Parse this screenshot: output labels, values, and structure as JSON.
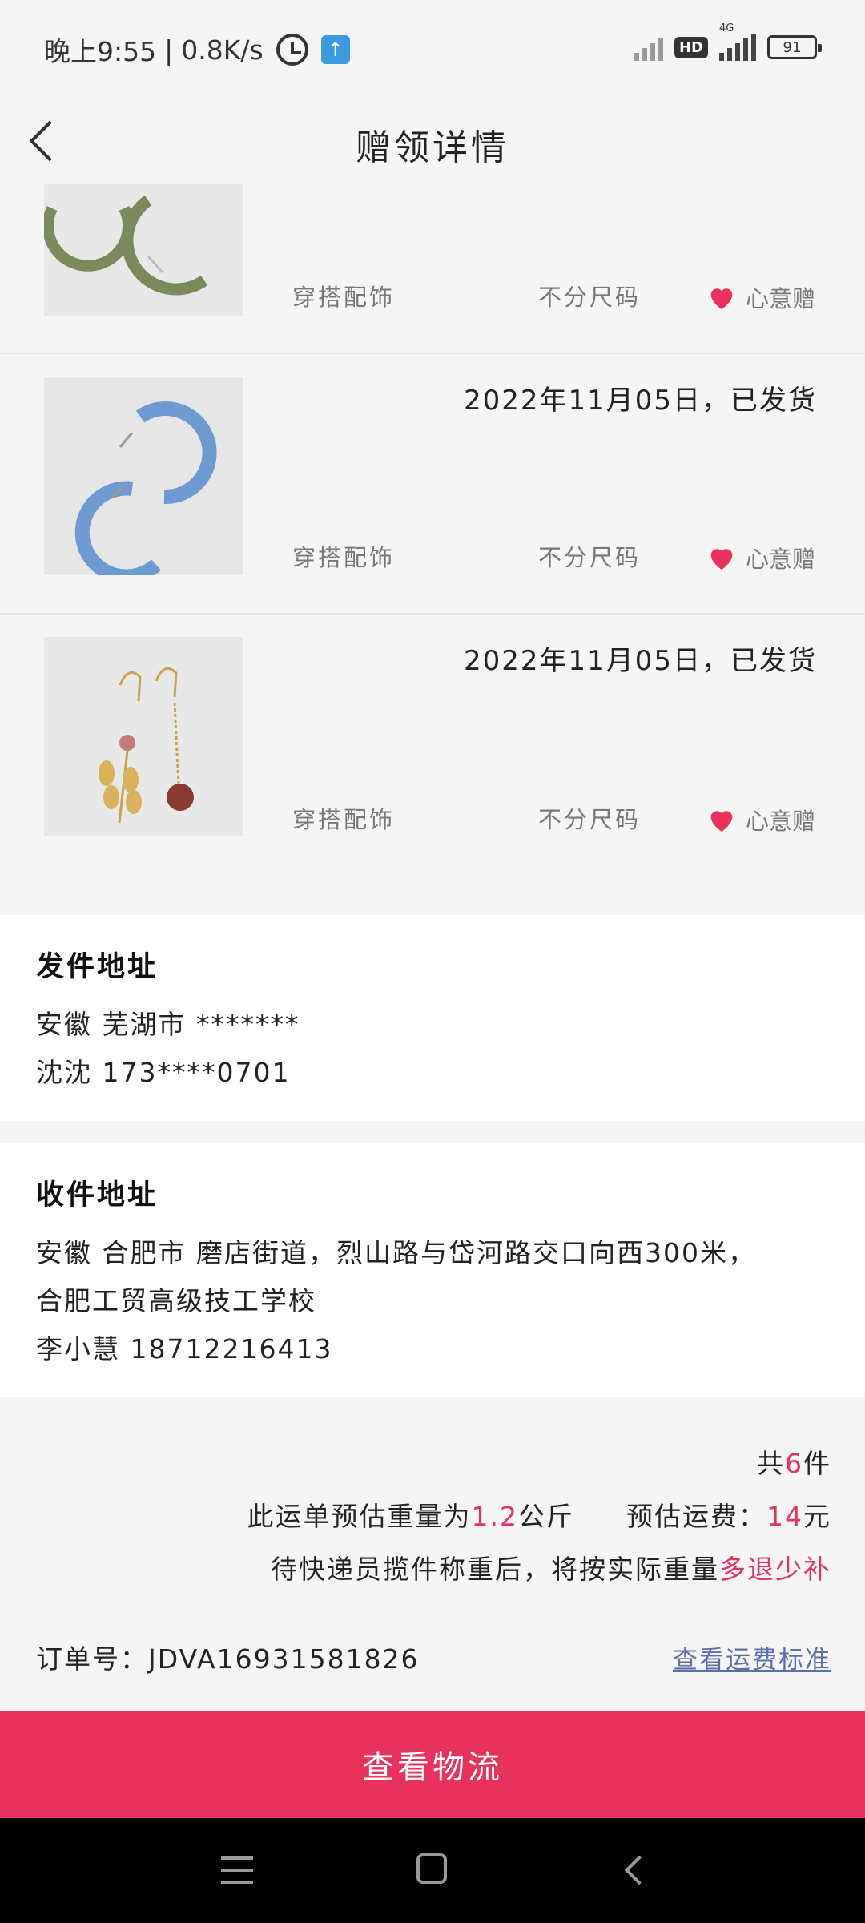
{
  "status_bar": {
    "time": "晚上9:55",
    "separator": "|",
    "speed": "0.8K/s",
    "battery": "91",
    "network_badge": "HD",
    "network_type": "4G"
  },
  "header": {
    "title": "赠领详情"
  },
  "items": [
    {
      "ship_date": "",
      "category": "穿搭配饰",
      "size": "不分尺码",
      "like_label": "心意赠",
      "image": "green-hoop-earrings"
    },
    {
      "ship_date": "2022年11月05日，已发货",
      "category": "穿搭配饰",
      "size": "不分尺码",
      "like_label": "心意赠",
      "image": "blue-hoop-earrings"
    },
    {
      "ship_date": "2022年11月05日，已发货",
      "category": "穿搭配饰",
      "size": "不分尺码",
      "like_label": "心意赠",
      "image": "leaf-bead-earrings"
    }
  ],
  "sender": {
    "title": "发件地址",
    "address": "安徽 芜湖市 *******",
    "contact": "沈沈 173****0701"
  },
  "receiver": {
    "title": "收件地址",
    "address_line1": "安徽 合肥市 磨店街道，烈山路与岱河路交口向西300米，",
    "address_line2": "合肥工贸高级技工学校",
    "contact": "李小慧 18712216413"
  },
  "summary": {
    "total_prefix": "共",
    "total_count": "6",
    "total_suffix": "件",
    "weight_prefix": "此运单预估重量为",
    "weight_value": "1.2",
    "weight_unit": "公斤",
    "fee_prefix": "预估运费：",
    "fee_value": "14",
    "fee_unit": "元",
    "note_prefix": "待快递员揽件称重后，将按实际重量",
    "note_highlight": "多退少补",
    "order_label": "订单号：",
    "order_no": "JDVA16931581826",
    "fee_link": "查看运费标准"
  },
  "actions": {
    "logistics_button": "查看物流"
  },
  "colors": {
    "accent": "#e8315b",
    "link": "#5b6fa7",
    "background": "#f5f5f5"
  }
}
